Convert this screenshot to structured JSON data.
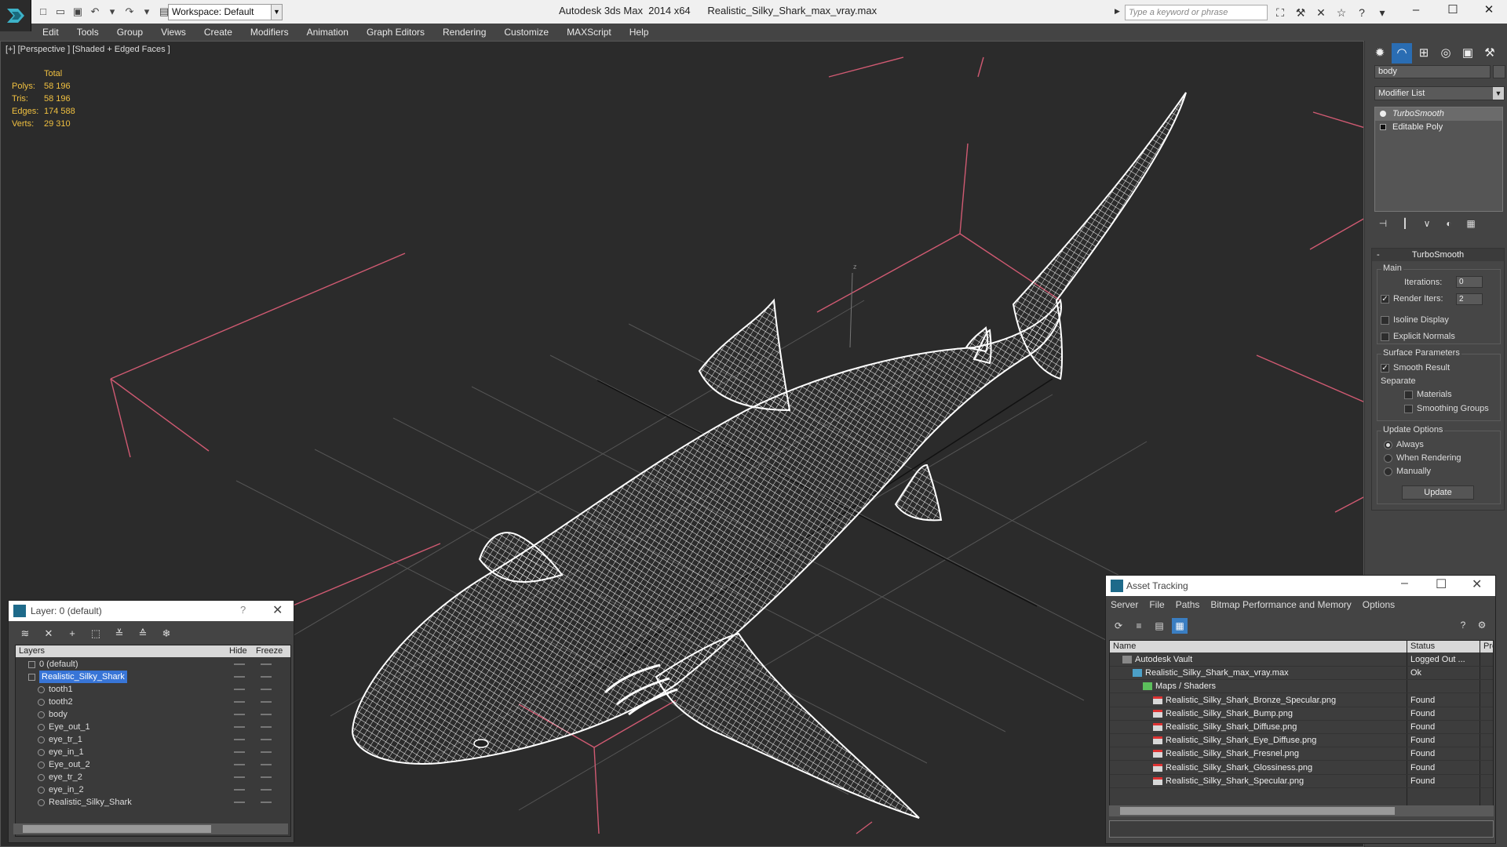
{
  "titlebar": {
    "app_title": "Autodesk 3ds Max  2014 x64",
    "file_name": "Realistic_Silky_Shark_max_vray.max",
    "workspace": "Workspace: Default",
    "search_placeholder": "Type a keyword or phrase"
  },
  "menu": [
    "Edit",
    "Tools",
    "Group",
    "Views",
    "Create",
    "Modifiers",
    "Animation",
    "Graph Editors",
    "Rendering",
    "Customize",
    "MAXScript",
    "Help"
  ],
  "viewport": {
    "label": "[+] [Perspective ] [Shaded + Edged Faces ]",
    "stats": {
      "header": "Total",
      "rows": [
        {
          "key": "Polys:",
          "value": "58 196"
        },
        {
          "key": "Tris:",
          "value": "58 196"
        },
        {
          "key": "Edges:",
          "value": "174 588"
        },
        {
          "key": "Verts:",
          "value": "29 310"
        }
      ]
    },
    "axis_label": "z"
  },
  "command_panel": {
    "object_name": "body",
    "modifier_list": "Modifier List",
    "stack": [
      "TurboSmooth",
      "Editable Poly"
    ],
    "rollout_title": "TurboSmooth",
    "main_label": "Main",
    "iterations_label": "Iterations:",
    "iterations_value": "0",
    "render_iters_label": "Render Iters:",
    "render_iters_value": "2",
    "isoline": "Isoline Display",
    "explicit_normals": "Explicit Normals",
    "surface_params": "Surface Parameters",
    "smooth_result": "Smooth Result",
    "separate": "Separate",
    "materials": "Materials",
    "smoothing_groups": "Smoothing Groups",
    "update_options": "Update Options",
    "always": "Always",
    "when_rendering": "When Rendering",
    "manually": "Manually",
    "update_button": "Update"
  },
  "layer_window": {
    "title": "Layer: 0 (default)",
    "columns": [
      "Layers",
      "Hide",
      "Freeze"
    ],
    "rows": [
      {
        "name": "0 (default)",
        "type": "layer"
      },
      {
        "name": "Realistic_Silky_Shark",
        "type": "layer-selected"
      },
      {
        "name": "tooth1",
        "type": "object"
      },
      {
        "name": "tooth2",
        "type": "object"
      },
      {
        "name": "body",
        "type": "object"
      },
      {
        "name": "Eye_out_1",
        "type": "object"
      },
      {
        "name": "eye_tr_1",
        "type": "object"
      },
      {
        "name": "eye_in_1",
        "type": "object"
      },
      {
        "name": "Eye_out_2",
        "type": "object"
      },
      {
        "name": "eye_tr_2",
        "type": "object"
      },
      {
        "name": "eye_in_2",
        "type": "object"
      },
      {
        "name": "Realistic_Silky_Shark",
        "type": "object"
      }
    ]
  },
  "asset_window": {
    "title": "Asset Tracking",
    "menu": [
      "Server",
      "File",
      "Paths",
      "Bitmap Performance and Memory",
      "Options"
    ],
    "columns": [
      "Name",
      "Status",
      "Pro"
    ],
    "rows": [
      {
        "name": "Autodesk Vault",
        "status": "Logged Out ...",
        "level": 0,
        "icon": "vault-icon"
      },
      {
        "name": "Realistic_Silky_Shark_max_vray.max",
        "status": "Ok",
        "level": 1,
        "icon": "max-file-icon"
      },
      {
        "name": "Maps / Shaders",
        "status": "",
        "level": 2,
        "icon": "maps-icon"
      },
      {
        "name": "Realistic_Silky_Shark_Bronze_Specular.png",
        "status": "Found",
        "level": 3,
        "icon": "png-icon"
      },
      {
        "name": "Realistic_Silky_Shark_Bump.png",
        "status": "Found",
        "level": 3,
        "icon": "png-icon"
      },
      {
        "name": "Realistic_Silky_Shark_Diffuse.png",
        "status": "Found",
        "level": 3,
        "icon": "png-icon"
      },
      {
        "name": "Realistic_Silky_Shark_Eye_Diffuse.png",
        "status": "Found",
        "level": 3,
        "icon": "png-icon"
      },
      {
        "name": "Realistic_Silky_Shark_Fresnel.png",
        "status": "Found",
        "level": 3,
        "icon": "png-icon"
      },
      {
        "name": "Realistic_Silky_Shark_Glossiness.png",
        "status": "Found",
        "level": 3,
        "icon": "png-icon"
      },
      {
        "name": "Realistic_Silky_Shark_Specular.png",
        "status": "Found",
        "level": 3,
        "icon": "png-icon"
      }
    ]
  },
  "colors": {
    "viewport_bg": "#2b2b2b",
    "stats_text": "#f0c040",
    "selection": "#3875d7",
    "active_tab": "#2a6db3"
  }
}
